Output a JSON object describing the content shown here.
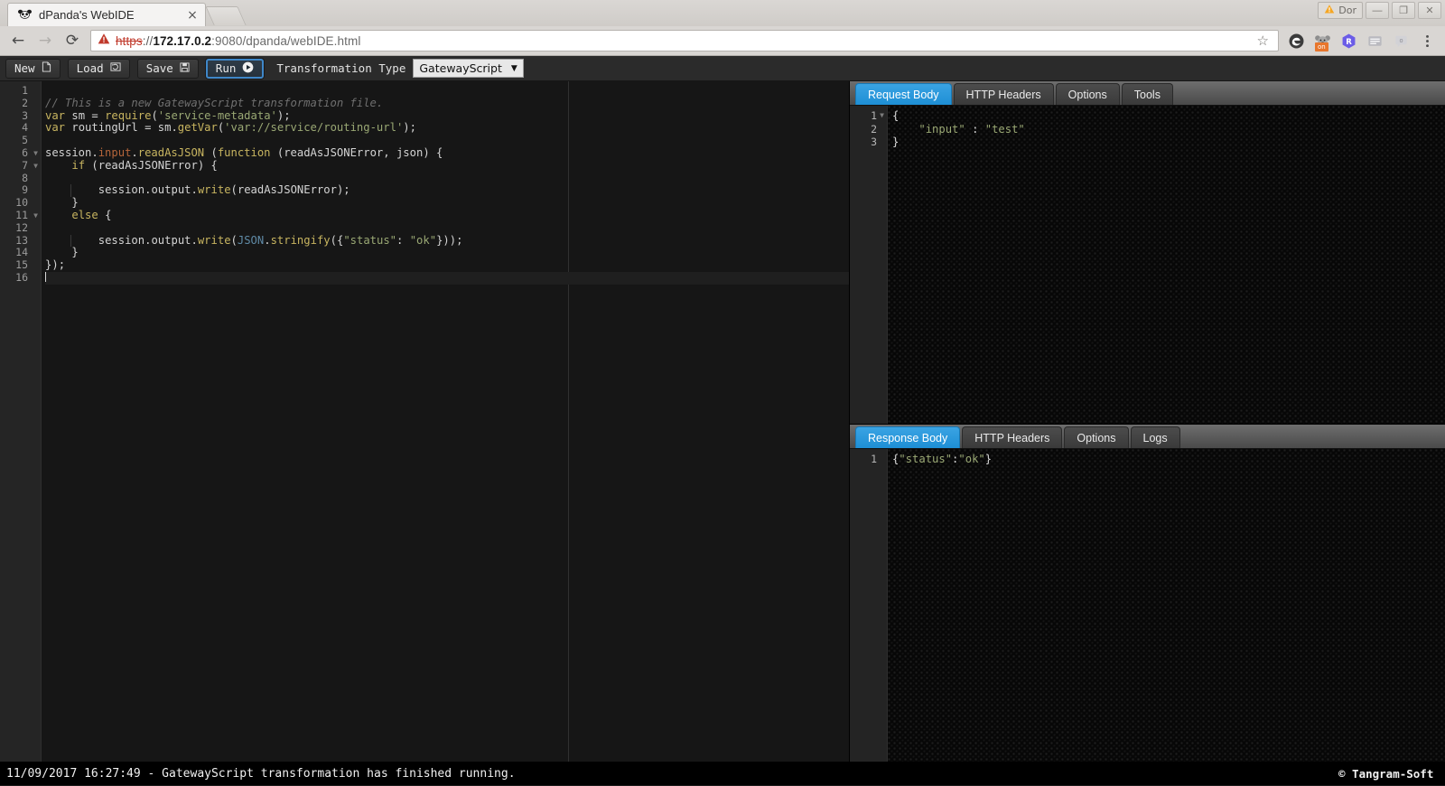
{
  "browser": {
    "tab": {
      "title": "dPanda's WebIDE",
      "favicon": "panda-icon",
      "close": "×"
    },
    "newtab_label": "",
    "window": {
      "warning_badge": "Dor",
      "minimize": "—",
      "maximize": "❐",
      "close": "✕"
    },
    "nav": {
      "back": "←",
      "forward": "→",
      "reload": "⟳",
      "bookmark_star": "☆"
    },
    "url": {
      "security_icon": "warning-triangle",
      "scheme": "https",
      "separator": "://",
      "host": "172.17.0.2",
      "rest": ":9080/dpanda/webIDE.html"
    },
    "extensions": [
      "edge-icon",
      "koala-extension-icon",
      "r-extension-icon",
      "reader-icon",
      "clipboard-icon",
      "menu-icon"
    ],
    "extension_badge": "on"
  },
  "toolbar": {
    "new_label": "New",
    "new_icon": "file-icon",
    "load_label": "Load",
    "load_icon": "folder-refresh-icon",
    "save_label": "Save",
    "save_icon": "floppy-icon",
    "run_label": "Run",
    "run_icon": "play-icon",
    "type_label": "Transformation Type",
    "type_value": "GatewayScript",
    "type_caret": "▼"
  },
  "editor": {
    "name": "gatewayscript-editor",
    "total_lines": 16,
    "cursor_line": 16,
    "fold_lines": [
      6,
      7,
      11
    ],
    "lines": [
      "",
      "// This is a new GatewayScript transformation file.",
      "var sm = require('service-metadata');",
      "var routingUrl = sm.getVar('var://service/routing-url');",
      "",
      "session.input.readAsJSON (function (readAsJSONError, json) {",
      "    if (readAsJSONError) {",
      "",
      "        session.output.write(readAsJSONError);",
      "    }",
      "    else {",
      "",
      "        session.output.write(JSON.stringify({\"status\": \"ok\"}));",
      "    }",
      "});",
      ""
    ]
  },
  "request_panel": {
    "name": "request-panel",
    "tabs": [
      {
        "label": "Request Body",
        "active": true
      },
      {
        "label": "HTTP Headers",
        "active": false
      },
      {
        "label": "Options",
        "active": false
      },
      {
        "label": "Tools",
        "active": false
      }
    ],
    "lines": [
      "{",
      "    \"input\" : \"test\"",
      "}"
    ],
    "line_numbers": [
      1,
      2,
      3
    ],
    "fold_lines": [
      1
    ]
  },
  "response_panel": {
    "name": "response-panel",
    "tabs": [
      {
        "label": "Response Body",
        "active": true
      },
      {
        "label": "HTTP Headers",
        "active": false
      },
      {
        "label": "Options",
        "active": false
      },
      {
        "label": "Logs",
        "active": false
      }
    ],
    "lines": [
      "{\"status\":\"ok\"}"
    ],
    "line_numbers": [
      1
    ]
  },
  "statusbar": {
    "message": "11/09/2017 16:27:49 - GatewayScript transformation has finished running.",
    "copyright": "© Tangram-Soft"
  },
  "colors": {
    "accent": "#2196d8",
    "run_border": "#3f87c8",
    "editor_bg": "#161616",
    "panel_bg": "#070707",
    "status_bg": "#000000",
    "comment": "#6f6f6f",
    "string": "#9aa874",
    "keyword": "#c8b560",
    "property": "#b5653a",
    "class": "#5f8aa6"
  }
}
